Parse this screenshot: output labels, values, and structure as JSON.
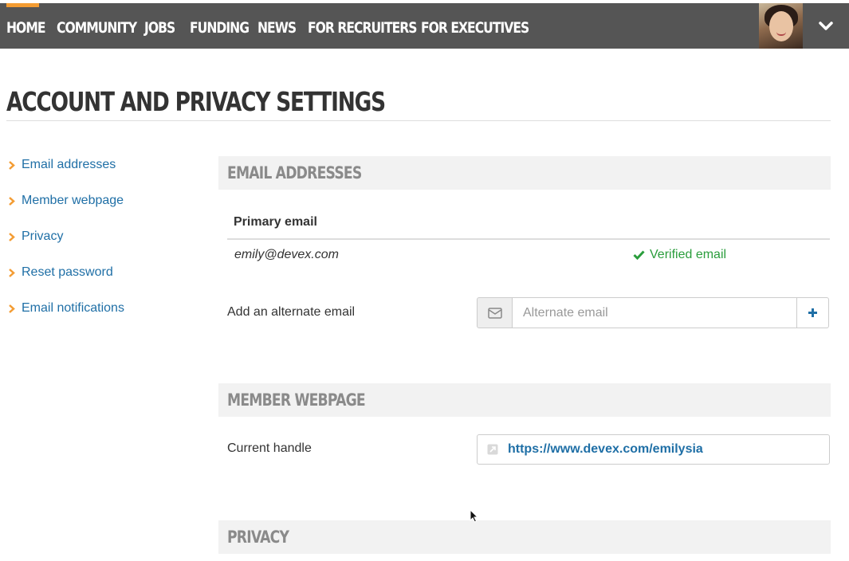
{
  "nav": {
    "items": [
      "Home",
      "Community",
      "Jobs",
      "Funding",
      "News",
      "For Recruiters",
      "For Executives"
    ],
    "active": "Home",
    "accent_color": "#f39c33",
    "bar_color": "#555555"
  },
  "page": {
    "title": "Account and Privacy Settings"
  },
  "sidebar": {
    "items": [
      {
        "label": "Email addresses"
      },
      {
        "label": "Member webpage"
      },
      {
        "label": "Privacy"
      },
      {
        "label": "Reset password"
      },
      {
        "label": "Email notifications"
      }
    ],
    "chevron_color": "#f39c33"
  },
  "email_section": {
    "heading": "Email Addresses",
    "primary_header": "Primary email",
    "primary_value": "emily@devex.com",
    "verified_label": "Verified email",
    "alternate_label": "Add an alternate email",
    "alternate_placeholder": "Alternate email",
    "alternate_value": ""
  },
  "webpage_section": {
    "heading": "Member Webpage",
    "handle_label": "Current handle",
    "handle_url": "https://www.devex.com/emilysia"
  },
  "privacy_section": {
    "heading": "Privacy"
  },
  "icons": {
    "sidebar_chevron": "chevron-right-icon",
    "verified": "check-icon",
    "alternate_addon": "envelope-icon",
    "add_button": "plus-icon",
    "handle": "link-icon",
    "menu_toggle": "chevron-down-icon"
  },
  "colors": {
    "link": "#1f6fa6",
    "verified": "#2a9d3c",
    "section_bg": "#f2f2f2"
  }
}
